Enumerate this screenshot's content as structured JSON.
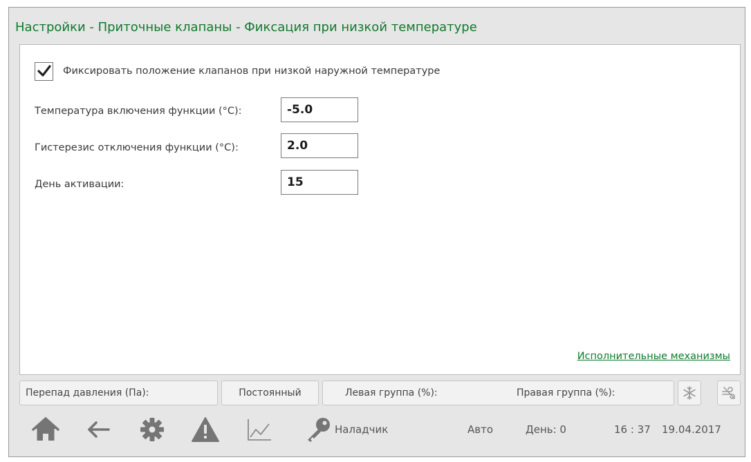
{
  "window": {
    "title": "Настройки - Приточные клапаны - Фиксация при низкой температуре"
  },
  "settings": {
    "fix_checkbox": {
      "label": "Фиксировать положение клапанов при низкой наружной температуре",
      "checked": true
    },
    "fields": [
      {
        "label": "Температура включения функции (°C):",
        "value": "-5.0"
      },
      {
        "label": "Гистерезис отключения функции (°C):",
        "value": "2.0"
      },
      {
        "label": "День активации:",
        "value": "15"
      }
    ],
    "link_label": "Исполнительные механизмы"
  },
  "status_bar": {
    "pressure_label": "Перепад давления (Па):",
    "mode_label": "Постоянный",
    "left_group_label": "Левая группа (%):",
    "right_group_label": "Правая группа (%):",
    "icons": [
      "snowflake-icon",
      "wind-off-icon"
    ]
  },
  "nav_bar": {
    "icons": [
      "home-icon",
      "back-arrow-icon",
      "gear-icon",
      "warning-icon",
      "chart-icon",
      "key-icon"
    ],
    "user_label": "Наладчик",
    "mode": "Авто",
    "day": "День: 0",
    "time": "16 : 37",
    "date": "19.04.2017"
  },
  "colors": {
    "accent_green": "#0f7a2c",
    "icon_gray": "#757575",
    "frame_bg": "#e6e6e6"
  }
}
